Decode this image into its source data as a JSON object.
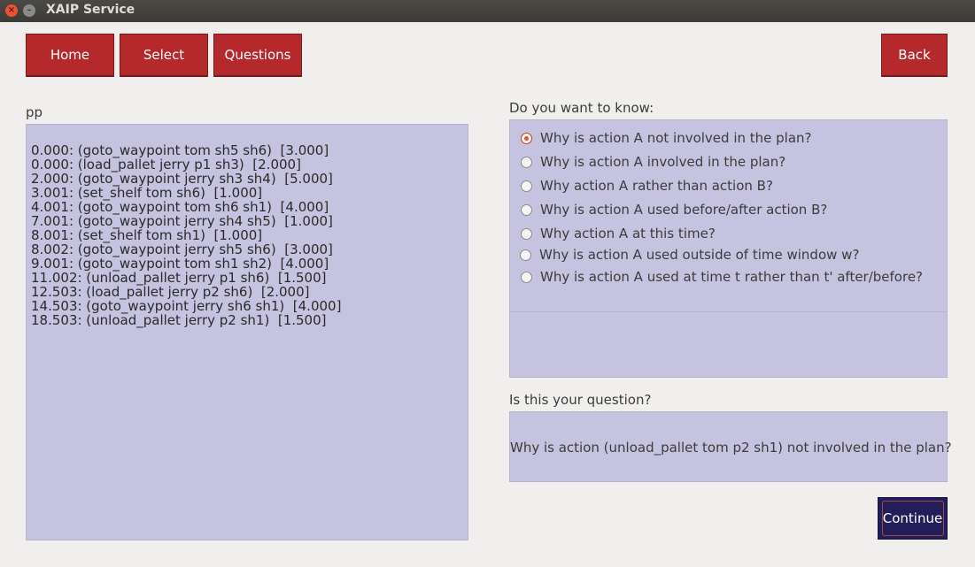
{
  "window": {
    "title": "XAIP Service",
    "close_glyph": "×",
    "min_glyph": "–"
  },
  "nav": {
    "home": "Home",
    "select": "Select",
    "questions": "Questions",
    "back": "Back"
  },
  "plan": {
    "label": "pp",
    "lines": [
      "0.000: (goto_waypoint tom sh5 sh6)  [3.000]",
      "0.000: (load_pallet jerry p1 sh3)  [2.000]",
      "2.000: (goto_waypoint jerry sh3 sh4)  [5.000]",
      "3.001: (set_shelf tom sh6)  [1.000]",
      "4.001: (goto_waypoint tom sh6 sh1)  [4.000]",
      "7.001: (goto_waypoint jerry sh4 sh5)  [1.000]",
      "8.001: (set_shelf tom sh1)  [1.000]",
      "8.002: (goto_waypoint jerry sh5 sh6)  [3.000]",
      "9.001: (goto_waypoint tom sh1 sh2)  [4.000]",
      "11.002: (unload_pallet jerry p1 sh6)  [1.500]",
      "12.503: (load_pallet jerry p2 sh6)  [2.000]",
      "14.503: (goto_waypoint jerry sh6 sh1)  [4.000]",
      "18.503: (unload_pallet jerry p2 sh1)  [1.500]"
    ]
  },
  "questions": {
    "label": "Do you want to know:",
    "selected_index": 0,
    "options": [
      "Why is action A not involved in the plan?",
      "Why is action A  involved in the plan?",
      "Why action A rather than action B?",
      "Why is action A used before/after action B?",
      "Why action A at this time?",
      "Why is action A used outside of time window w?",
      "Why is action A used at time t rather than t' after/before?"
    ]
  },
  "confirm": {
    "label": "Is this your question?",
    "question": "Why is action (unload_pallet tom p2 sh1) not involved in the plan?"
  },
  "continue_label": "Continue",
  "colors": {
    "accent_red": "#b5282c",
    "panel": "#c5c3df",
    "continue_bg": "#231e5a",
    "radio_selected": "#e05a29"
  }
}
